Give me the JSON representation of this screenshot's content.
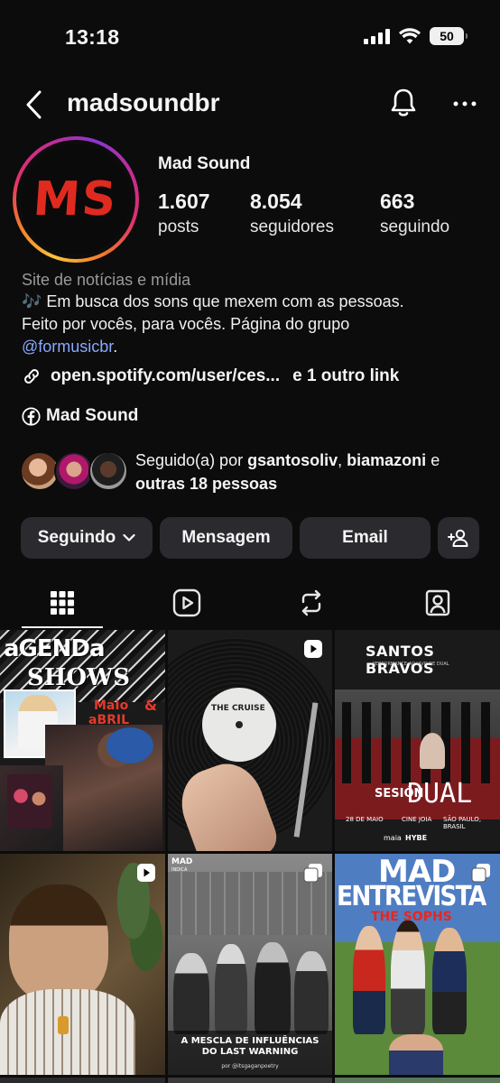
{
  "status_bar": {
    "time": "13:18",
    "battery": "50"
  },
  "header": {
    "username": "madsoundbr",
    "icons": [
      "back-icon",
      "bell-icon",
      "more-icon"
    ]
  },
  "profile": {
    "avatar_text": "MS",
    "display_name": "Mad Sound",
    "stats": [
      {
        "value": "1.607",
        "label": "posts"
      },
      {
        "value": "8.054",
        "label": "seguidores"
      },
      {
        "value": "663",
        "label": "seguindo"
      }
    ],
    "category": "Site de notícias e mídia",
    "bio_line1": "🎶 Em busca dos sons que mexem com as pessoas.",
    "bio_line2": "Feito por vocês, para vocês. Página do grupo",
    "bio_mention": "@formusicbr",
    "bio_after_mention": ".",
    "link_text": "open.spotify.com/user/ces...",
    "link_extra": "e 1 outro link",
    "facebook_name": "Mad Sound",
    "followed_by_prefix": "Seguido(a) por",
    "followed_by_user1": "gsantosoliv",
    "followed_by_sep": ",",
    "followed_by_user2": "biamazoni",
    "followed_by_and": "e",
    "followed_by_others": "outras 18 pessoas"
  },
  "actions": {
    "following_label": "Seguindo",
    "message_label": "Mensagem",
    "email_label": "Email"
  },
  "tabs": [
    "grid-icon",
    "reels-icon",
    "reposts-icon",
    "tagged-icon"
  ],
  "posts": {
    "p1_line1": "aGENDa",
    "p1_line2": "SHOWS",
    "p1_line3": "MaIo",
    "p1_line4": "aBRIL",
    "p1_amp": "&",
    "p2_label": "THE CRUISE",
    "p3_title": "SANTOS BRAVOS",
    "p3_sub": "PERFORMANCE AO VIVO DE DUAL",
    "p3_sesion": "SESIÓN",
    "p3_dual": "DUAL",
    "p3_date": "28 DE MAIO",
    "p3_venue": "CINE JOIA",
    "p3_city": "SÃO PAULO, BRASIL",
    "p3_brand1": "maia",
    "p3_brand2": "HYBE",
    "p5_tag": "MAD",
    "p5_tag2": "INDICA",
    "p5_caption1": "A MESCLA DE INFLUÊNCIAS",
    "p5_caption2": "DO LAST WARNING",
    "p5_credit": "por @itsgaganpoetry",
    "p6_title1": "MAD",
    "p6_title2": "ENTREVISTA",
    "p6_sub": "THE SOPHS"
  },
  "colors": {
    "background": "#0c0c0c",
    "button": "#2b2b2f",
    "mention": "#8aa8ff",
    "logo_red": "#e02a20"
  }
}
